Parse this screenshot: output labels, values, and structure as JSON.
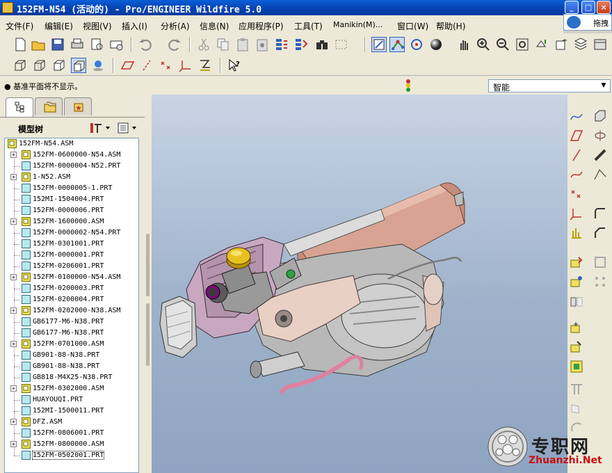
{
  "window": {
    "title": "152FM-N54 (活动的) - Pro/ENGINEER Wildfire 5.0",
    "minimize": "_",
    "maximize": "□",
    "close": "×"
  },
  "floating_toolbar": {
    "label": "拖拽"
  },
  "menu": [
    "文件(F)",
    "编辑(E)",
    "视图(V)",
    "插入(I)",
    "分析(A)",
    "信息(N)",
    "应用程序(P)",
    "工具(T)",
    "Manikin(M)...",
    "窗口(W)",
    "帮助(H)"
  ],
  "message": "● 基准平面将不显示。",
  "filter": {
    "value": "智能"
  },
  "model_tree": {
    "title": "模型树",
    "root": "152FM-N54.ASM",
    "items": [
      {
        "label": "152FM-0600000-N54.ASM",
        "type": "asm",
        "expandable": true
      },
      {
        "label": "152FM-0000004-N52.PRT",
        "type": "prt",
        "expandable": false
      },
      {
        "label": "1-N52.ASM",
        "type": "asm",
        "expandable": true
      },
      {
        "label": "152FM-0000005-1.PRT",
        "type": "prt",
        "expandable": false
      },
      {
        "label": "152MI-1504004.PRT",
        "type": "prt",
        "expandable": false
      },
      {
        "label": "152FM-0000006.PRT",
        "type": "prt",
        "expandable": false
      },
      {
        "label": "152FM-1600000.ASM",
        "type": "asm",
        "expandable": true
      },
      {
        "label": "152FM-0000002-N54.PRT",
        "type": "prt",
        "expandable": false
      },
      {
        "label": "152FM-0301001.PRT",
        "type": "prt",
        "expandable": false
      },
      {
        "label": "152FM-0000001.PRT",
        "type": "prt",
        "expandable": false
      },
      {
        "label": "152FM-0206001.PRT",
        "type": "prt",
        "expandable": false
      },
      {
        "label": "152FM-0100000-N54.ASM",
        "type": "asm",
        "expandable": true
      },
      {
        "label": "152FM-0200003.PRT",
        "type": "prt",
        "expandable": false
      },
      {
        "label": "152FM-0200004.PRT",
        "type": "prt",
        "expandable": false
      },
      {
        "label": "152FM-0202000-N38.ASM",
        "type": "asm",
        "expandable": true
      },
      {
        "label": "GB6177-M6-N38.PRT",
        "type": "prt",
        "expandable": false
      },
      {
        "label": "GB6177-M6-N38.PRT",
        "type": "prt",
        "expandable": false
      },
      {
        "label": "152FM-0701000.ASM",
        "type": "asm",
        "expandable": true
      },
      {
        "label": "GB901-88-N38.PRT",
        "type": "prt",
        "expandable": false
      },
      {
        "label": "GB901-88-N38.PRT",
        "type": "prt",
        "expandable": false
      },
      {
        "label": "GB818-M4X25-N38.PRT",
        "type": "prt",
        "expandable": false
      },
      {
        "label": "152FM-0302000.ASM",
        "type": "asm",
        "expandable": true
      },
      {
        "label": "HUAYOUQI.PRT",
        "type": "prt",
        "expandable": false
      },
      {
        "label": "152MI-1500011.PRT",
        "type": "prt",
        "expandable": false
      },
      {
        "label": "DFZ.ASM",
        "type": "asm",
        "expandable": true
      },
      {
        "label": "152FM-0806001.PRT",
        "type": "prt",
        "expandable": false
      },
      {
        "label": "152FM-0800000.ASM",
        "type": "asm",
        "expandable": true
      },
      {
        "label": "152FM-0502001.PRT",
        "type": "prt",
        "expandable": false,
        "selected": true
      }
    ]
  },
  "watermark": {
    "main": "专职网",
    "url": "Zhuanzhi.Net"
  },
  "colors": {
    "titlebar": "#0847b8",
    "viewport_top": "#c7d4e4",
    "viewport_bottom": "#8ea4c1",
    "muffler": "#d9a08c",
    "crankcase": "#b8b8b8",
    "cylinder_head": "#c8a8c0",
    "oil_cap": "#e8c020",
    "hose": "#e080a0"
  }
}
